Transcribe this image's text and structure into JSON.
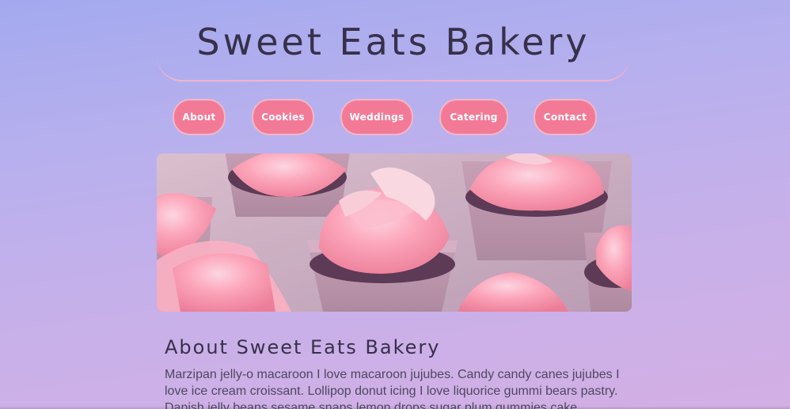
{
  "header": {
    "title": "Sweet Eats Bakery"
  },
  "nav": {
    "items": [
      {
        "label": "About"
      },
      {
        "label": "Cookies"
      },
      {
        "label": "Weddings"
      },
      {
        "label": "Catering"
      },
      {
        "label": "Contact"
      }
    ]
  },
  "hero": {
    "alt": "Pink frosted cupcakes in purple cups"
  },
  "about": {
    "heading": "About Sweet Eats Bakery",
    "body": "Marzipan jelly-o macaroon I love macaroon jujubes. Candy candy canes jujubes I love ice cream croissant. Lollipop donut icing I love liquorice gummi bears pastry. Danish jelly beans sesame snaps lemon drops sugar plum gummies cake."
  },
  "colors": {
    "accent": "#f37a97",
    "accent_border": "#f1b8c7",
    "title_text": "#36304a",
    "body_text": "#4e4760",
    "frosting": "#ff9fb4"
  }
}
